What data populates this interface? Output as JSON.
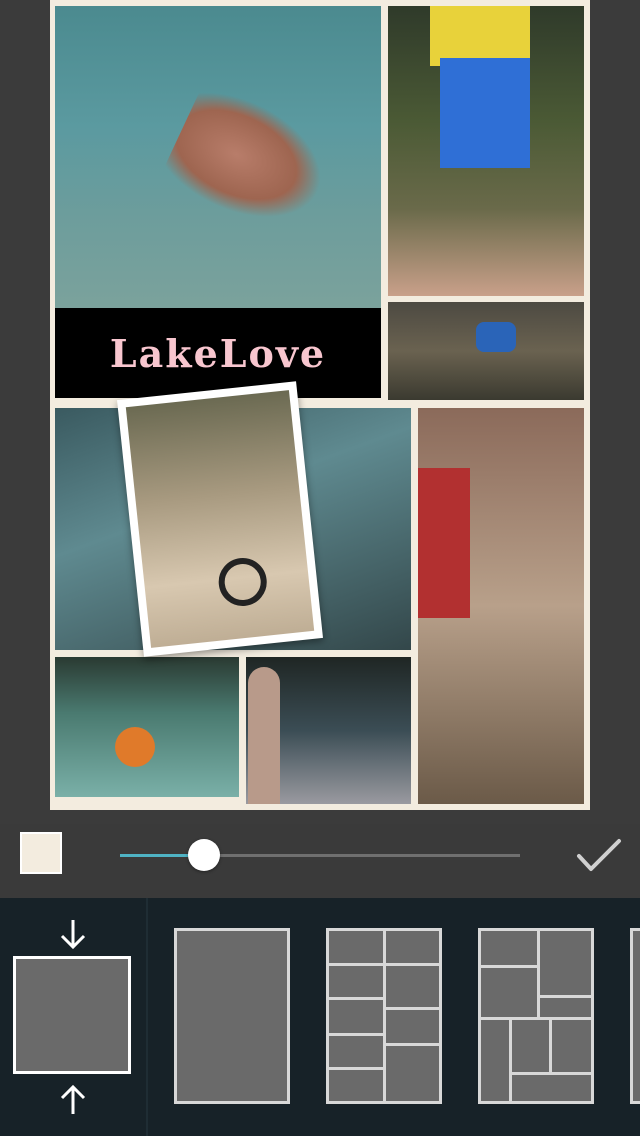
{
  "collage": {
    "background_color": "#f3ecdf",
    "banner_text": "LakeLove",
    "photos": [
      {
        "icon": "swimmer-photo"
      },
      {
        "icon": "child-legs-photo"
      },
      {
        "icon": "child-in-water-photo"
      },
      {
        "icon": "lake-shore-photo"
      },
      {
        "icon": "hand-in-water-photo"
      },
      {
        "icon": "tubing-photo"
      },
      {
        "icon": "canoe-photo"
      },
      {
        "icon": "tire-swing-polaroid"
      }
    ]
  },
  "controls": {
    "border_color": "#f3ecdf",
    "slider_value_percent": 21,
    "slider_fill_color": "#4fb3c4",
    "confirm_icon": "check-icon"
  },
  "layouts": [
    {
      "name": "fit",
      "icon": "fit-arrows-icon"
    },
    {
      "name": "single"
    },
    {
      "name": "grid-two-column"
    },
    {
      "name": "grid-mixed"
    }
  ]
}
